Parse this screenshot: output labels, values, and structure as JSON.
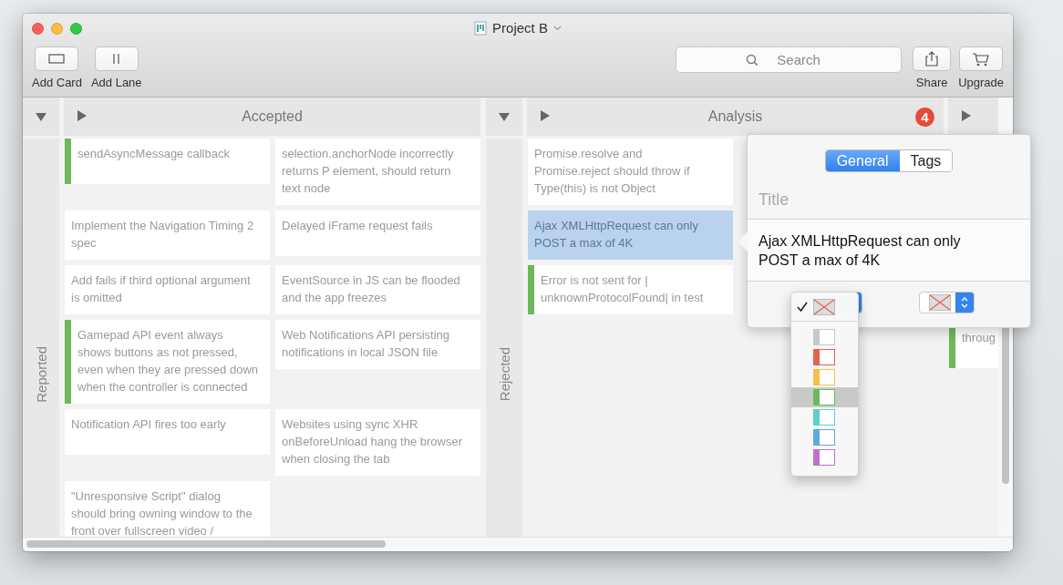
{
  "window": {
    "title": "Project B"
  },
  "toolbar": {
    "left": [
      {
        "kind": "card",
        "label": "Add Card"
      },
      {
        "kind": "lane",
        "label": "Add Lane"
      }
    ],
    "search": {
      "placeholder": "Search"
    },
    "right": [
      {
        "kind": "share",
        "label": "Share"
      },
      {
        "kind": "cart",
        "label": "Upgrade"
      }
    ]
  },
  "swimlanes": [
    {
      "name": "Reported",
      "expanded": true,
      "lanes": [
        {
          "name": "Accepted",
          "rows": [
            [
              {
                "text": "sendAsyncMessage callback",
                "color": "#6cb85a",
                "selected": false
              },
              {
                "text": "selection.anchorNode incorrectly returns P element, should return text node",
                "selected": false
              }
            ],
            [
              {
                "text": "Implement the Navigation Timing 2 spec",
                "selected": false
              },
              {
                "text": "Delayed iFrame request fails",
                "selected": false
              }
            ],
            [
              {
                "text": "Add fails if third optional argument is omitted",
                "selected": false
              },
              {
                "text": "EventSource in JS can be flooded and the app freezes",
                "selected": false
              }
            ],
            [
              {
                "text": "Gamepad API event always shows buttons as not pressed, even when they are pressed down when the controller is connected",
                "color": "#6cb85a",
                "selected": false
              },
              {
                "text": "Web Notifications API persisting notifications in local JSON file",
                "selected": false
              }
            ],
            [
              {
                "text": "Notification API fires too early",
                "selected": false
              },
              {
                "text": "Websites using sync XHR onBeforeUnload hang the browser when closing the tab",
                "selected": false
              }
            ],
            [
              {
                "text": "\"Unresponsive Script\" dialog should bring owning window to the front over fullscreen video /",
                "selected": false
              }
            ]
          ]
        }
      ]
    },
    {
      "name": "Rejected",
      "expanded": true,
      "lanes": [
        {
          "name": "Analysis",
          "badge": "4",
          "rows": [
            [
              {
                "text": "Promise.resolve and Promise.reject should throw if Type(this) is not Object",
                "selected": false
              }
            ],
            [
              {
                "text": "Ajax XMLHttpRequest can only POST a max of 4K",
                "selected": true
              }
            ],
            [
              {
                "text": "Error is not sent for | unknownProtocolFound| in test",
                "color": "#6cb85a",
                "selected": false
              }
            ]
          ]
        },
        {
          "rows": [
            [
              {
                "text": "throug",
                "color": "#6cb85a",
                "selected": false
              }
            ]
          ]
        }
      ]
    }
  ],
  "popover": {
    "tabs": [
      {
        "label": "General",
        "selected": true
      },
      {
        "label": "Tags",
        "selected": false
      }
    ],
    "title_label": "Title",
    "title_value": "Ajax XMLHttpRequest can only POST a max of 4K"
  },
  "color_menu": {
    "items": [
      {
        "kind": "none",
        "checked": true,
        "selected": false
      },
      {
        "kind": "color",
        "color": "#c8c8c8",
        "checked": false,
        "selected": false
      },
      {
        "kind": "color",
        "color": "#e8604f",
        "checked": false,
        "selected": false
      },
      {
        "kind": "color",
        "color": "#f5c04a",
        "checked": false,
        "selected": false
      },
      {
        "kind": "color",
        "color": "#6cb85a",
        "checked": false,
        "selected": true
      },
      {
        "kind": "color",
        "color": "#5fd0c4",
        "checked": false,
        "selected": false
      },
      {
        "kind": "color",
        "color": "#5aabe0",
        "checked": false,
        "selected": false
      },
      {
        "kind": "color",
        "color": "#c070d0",
        "checked": false,
        "selected": false
      }
    ]
  }
}
